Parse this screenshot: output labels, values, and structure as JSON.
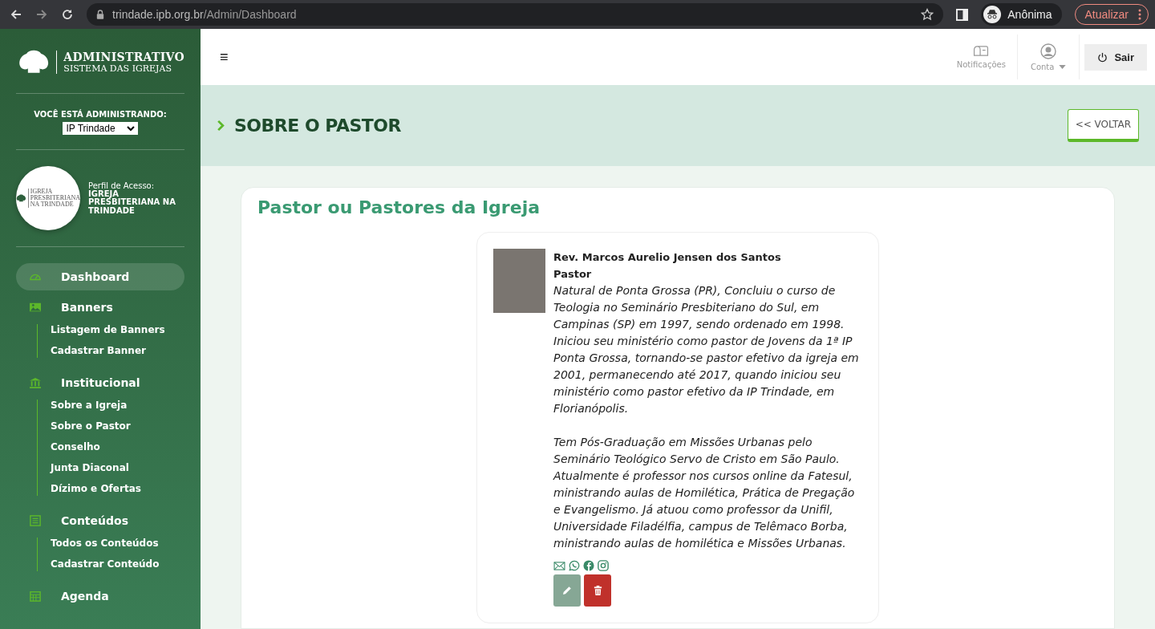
{
  "browser": {
    "url_host": "trindade.ipb.org.br",
    "url_path": "/Admin/Dashboard",
    "profile": "Anônima",
    "update_button": "Atualizar"
  },
  "sidebar": {
    "logo_title": "ADMINISTRATIVO",
    "logo_subtitle": "SISTEMA DAS IGREJAS",
    "admin_label": "VOCÊ ESTÁ ADMINISTRANDO:",
    "church_select": "IP Trindade",
    "profile": {
      "avatar_line1": "IGREJA",
      "avatar_line2": "PRESBITERIANA",
      "avatar_line3": "NA TRINDADE",
      "label": "Perfil de Acesso:",
      "name": "IGREJA PRESBITERIANA NA TRINDADE"
    },
    "items": [
      {
        "label": "Dashboard",
        "selected": true
      },
      {
        "label": "Banners",
        "selected": false,
        "children": [
          {
            "label": "Listagem de Banners"
          },
          {
            "label": "Cadastrar Banner"
          }
        ]
      },
      {
        "label": "Institucional",
        "selected": false,
        "children": [
          {
            "label": "Sobre a Igreja"
          },
          {
            "label": "Sobre o Pastor"
          },
          {
            "label": "Conselho"
          },
          {
            "label": "Junta Diaconal"
          },
          {
            "label": "Dízimo e Ofertas"
          }
        ]
      },
      {
        "label": "Conteúdos",
        "selected": false,
        "children": [
          {
            "label": "Todos os Conteúdos"
          },
          {
            "label": "Cadastrar Conteúdo"
          }
        ]
      },
      {
        "label": "Agenda",
        "selected": false
      }
    ]
  },
  "header": {
    "menu_glyph": "≡",
    "notifications": "Notificações",
    "account": "Conta",
    "logout": "Sair"
  },
  "page": {
    "title": "SOBRE O PASTOR",
    "back_button": "<< VOLTAR"
  },
  "card": {
    "title": "Pastor ou Pastores da Igreja",
    "pastors": [
      {
        "name": "Rev. Marcos Aurelio Jensen dos Santos",
        "role": "Pastor",
        "bio": [
          "Natural de Ponta Grossa (PR), Concluiu o curso de Teologia no Seminário Presbiteriano do Sul, em Campinas (SP) em 1997, sendo ordenado em 1998. Iniciou seu ministério como pastor de Jovens da 1ª IP Ponta Grossa, tornando-se pastor efetivo da igreja em 2001, permanecendo até 2017, quando iniciou seu ministério como pastor efetivo da IP Trindade, em Florianópolis.",
          "Tem Pós-Graduação em Missões Urbanas pelo Seminário Teológico Servo de Cristo em São Paulo. Atualmente é professor nos cursos online da Fatesul, ministrando aulas de Homilética, Prática de Pregação e Evangelismo. Já atuou como professor da Unifil, Universidade Filadélfia, campus de Telêmaco Borba, ministrando aulas de homilética e Missões Urbanas."
        ]
      }
    ]
  }
}
